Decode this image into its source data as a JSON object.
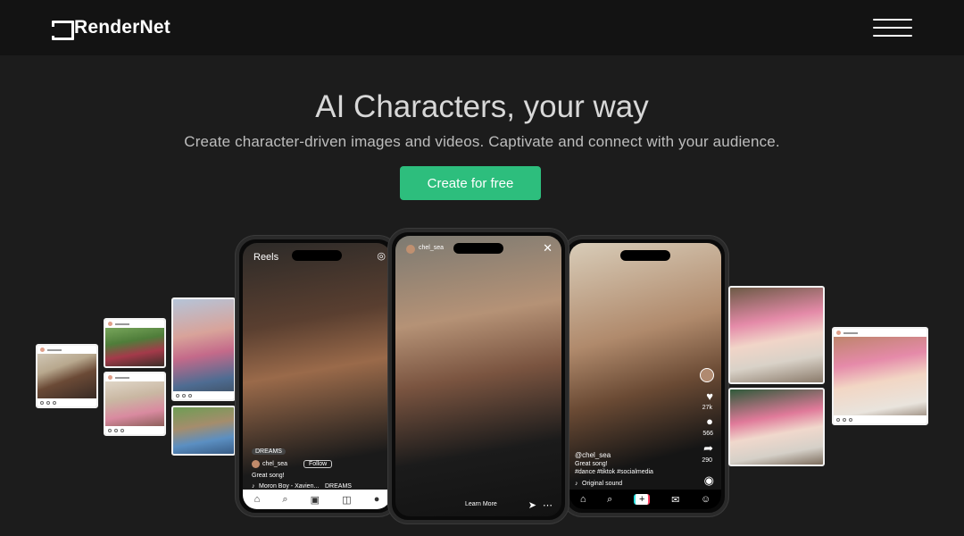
{
  "nav": {
    "logo_text": "RenderNet",
    "menu_icon": "hamburger-menu-icon"
  },
  "hero": {
    "title": "AI Characters, your way",
    "subtitle": "Create character-driven images and videos. Captivate and connect with your audience.",
    "cta_label": "Create for free"
  },
  "phones": {
    "left": {
      "header": "Reels",
      "badge": "DREAMS",
      "username": "chel_sea",
      "follow": "Follow",
      "caption": "Great song!",
      "music": "Moron Boy - Xavien...",
      "music_tag": "DREAMS"
    },
    "center": {
      "username": "chel_sea",
      "learn_more": "Learn More"
    },
    "right": {
      "likes": "27k",
      "comments": "566",
      "shares": "290",
      "username": "@chel_sea",
      "caption_line1": "Great song!",
      "caption_line2": "#dance #tiktok #socialmedia",
      "sound": "Original sound"
    }
  },
  "colors": {
    "background": "#1c1c1c",
    "nav_background": "#131313",
    "accent": "#2dbe7d"
  }
}
